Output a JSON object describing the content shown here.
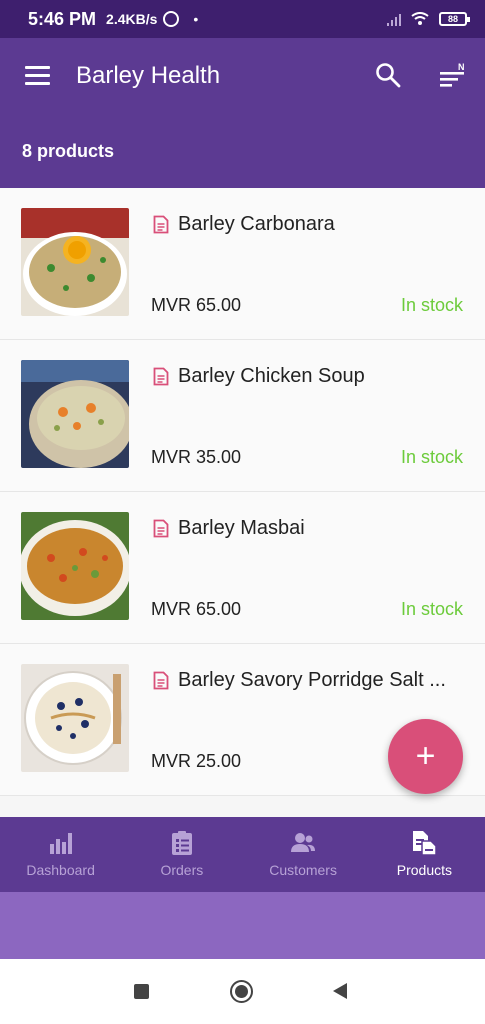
{
  "status_bar": {
    "time": "5:46 PM",
    "speed": "2.4KB/s",
    "dot": "•",
    "battery": "88"
  },
  "app_bar": {
    "title": "Barley Health",
    "product_count": "8 products"
  },
  "products": [
    {
      "name": "Barley Carbonara",
      "price": "MVR 65.00",
      "stock": "In stock"
    },
    {
      "name": "Barley Chicken Soup",
      "price": "MVR 35.00",
      "stock": "In stock"
    },
    {
      "name": "Barley Masbai",
      "price": "MVR 65.00",
      "stock": "In stock"
    },
    {
      "name": "Barley Savory Porridge Salt ...",
      "price": "MVR 25.00",
      "stock": ""
    }
  ],
  "fab": {
    "icon": "+"
  },
  "bottom_nav": [
    {
      "label": "Dashboard",
      "icon": "bar-chart-icon"
    },
    {
      "label": "Orders",
      "icon": "clipboard-icon"
    },
    {
      "label": "Customers",
      "icon": "people-icon"
    },
    {
      "label": "Products",
      "icon": "documents-icon",
      "active": true
    }
  ],
  "colors": {
    "status_bar": "#3e1f6e",
    "app_bar": "#5c3a92",
    "accent": "#d94f79",
    "in_stock": "#6ccb3b"
  }
}
